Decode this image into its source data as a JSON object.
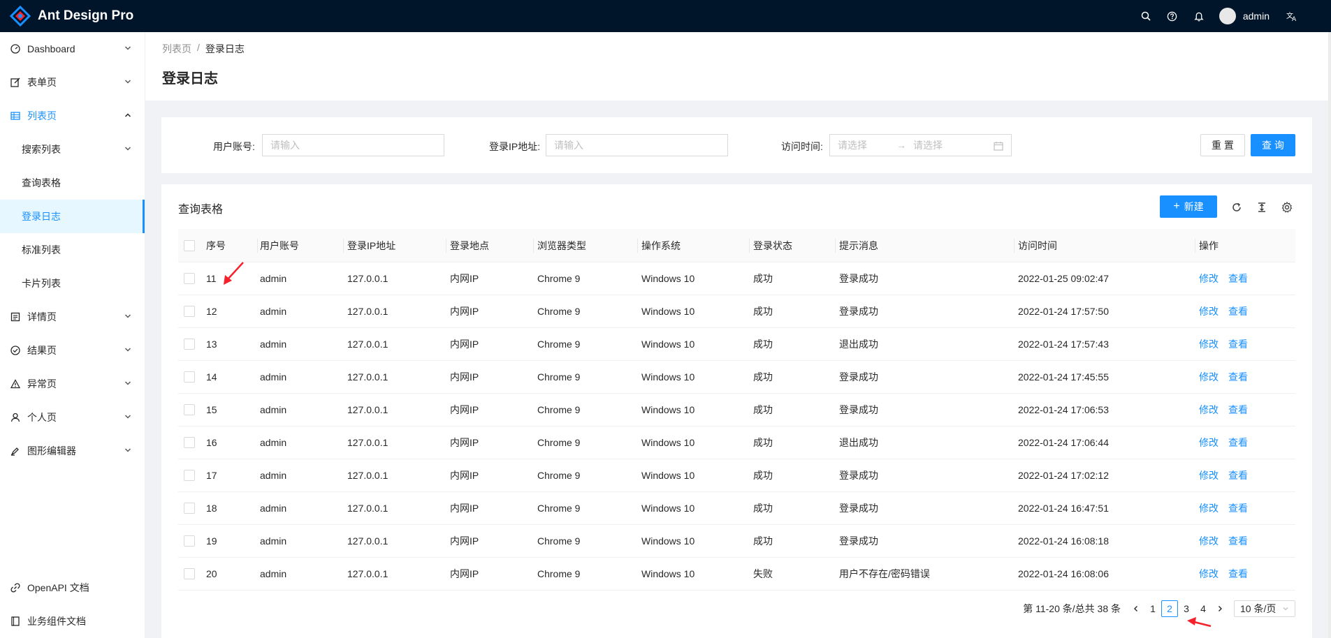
{
  "header": {
    "title": "Ant Design Pro",
    "user": "admin"
  },
  "sidebar": {
    "items": [
      {
        "label": "Dashboard"
      },
      {
        "label": "表单页"
      },
      {
        "label": "列表页"
      },
      {
        "label": "详情页"
      },
      {
        "label": "结果页"
      },
      {
        "label": "异常页"
      },
      {
        "label": "个人页"
      },
      {
        "label": "图形编辑器"
      }
    ],
    "sub_items": [
      {
        "label": "搜索列表"
      },
      {
        "label": "查询表格"
      },
      {
        "label": "登录日志"
      },
      {
        "label": "标准列表"
      },
      {
        "label": "卡片列表"
      }
    ],
    "bottom": [
      {
        "label": "OpenAPI 文档"
      },
      {
        "label": "业务组件文档"
      }
    ]
  },
  "page": {
    "breadcrumb": [
      "列表页",
      "登录日志"
    ],
    "title": "登录日志"
  },
  "search": {
    "account_label": "用户账号:",
    "account_placeholder": "请输入",
    "ip_label": "登录IP地址:",
    "ip_placeholder": "请输入",
    "time_label": "访问时间:",
    "time_start_placeholder": "请选择",
    "time_end_placeholder": "请选择",
    "reset_label": "重 置",
    "query_label": "查 询"
  },
  "table": {
    "title": "查询表格",
    "new_label": "新建",
    "columns": [
      "序号",
      "用户账号",
      "登录IP地址",
      "登录地点",
      "浏览器类型",
      "操作系统",
      "登录状态",
      "提示消息",
      "访问时间",
      "操作"
    ],
    "action_edit": "修改",
    "action_view": "查看",
    "rows": [
      [
        "11",
        "admin",
        "127.0.0.1",
        "内网IP",
        "Chrome 9",
        "Windows 10",
        "成功",
        "登录成功",
        "2022-01-25 09:02:47"
      ],
      [
        "12",
        "admin",
        "127.0.0.1",
        "内网IP",
        "Chrome 9",
        "Windows 10",
        "成功",
        "登录成功",
        "2022-01-24 17:57:50"
      ],
      [
        "13",
        "admin",
        "127.0.0.1",
        "内网IP",
        "Chrome 9",
        "Windows 10",
        "成功",
        "退出成功",
        "2022-01-24 17:57:43"
      ],
      [
        "14",
        "admin",
        "127.0.0.1",
        "内网IP",
        "Chrome 9",
        "Windows 10",
        "成功",
        "登录成功",
        "2022-01-24 17:45:55"
      ],
      [
        "15",
        "admin",
        "127.0.0.1",
        "内网IP",
        "Chrome 9",
        "Windows 10",
        "成功",
        "登录成功",
        "2022-01-24 17:06:53"
      ],
      [
        "16",
        "admin",
        "127.0.0.1",
        "内网IP",
        "Chrome 9",
        "Windows 10",
        "成功",
        "退出成功",
        "2022-01-24 17:06:44"
      ],
      [
        "17",
        "admin",
        "127.0.0.1",
        "内网IP",
        "Chrome 9",
        "Windows 10",
        "成功",
        "登录成功",
        "2022-01-24 17:02:12"
      ],
      [
        "18",
        "admin",
        "127.0.0.1",
        "内网IP",
        "Chrome 9",
        "Windows 10",
        "成功",
        "登录成功",
        "2022-01-24 16:47:51"
      ],
      [
        "19",
        "admin",
        "127.0.0.1",
        "内网IP",
        "Chrome 9",
        "Windows 10",
        "成功",
        "登录成功",
        "2022-01-24 16:08:18"
      ],
      [
        "20",
        "admin",
        "127.0.0.1",
        "内网IP",
        "Chrome 9",
        "Windows 10",
        "失败",
        "用户不存在/密码错误",
        "2022-01-24 16:08:06"
      ]
    ]
  },
  "pagination": {
    "total_text": "第 11-20 条/总共 38 条",
    "pages": [
      "1",
      "2",
      "3",
      "4"
    ],
    "current": "2",
    "page_size": "10 条/页"
  },
  "colors": {
    "primary": "#1890ff",
    "header_bg": "#001529",
    "annotation": "#f5222d"
  }
}
